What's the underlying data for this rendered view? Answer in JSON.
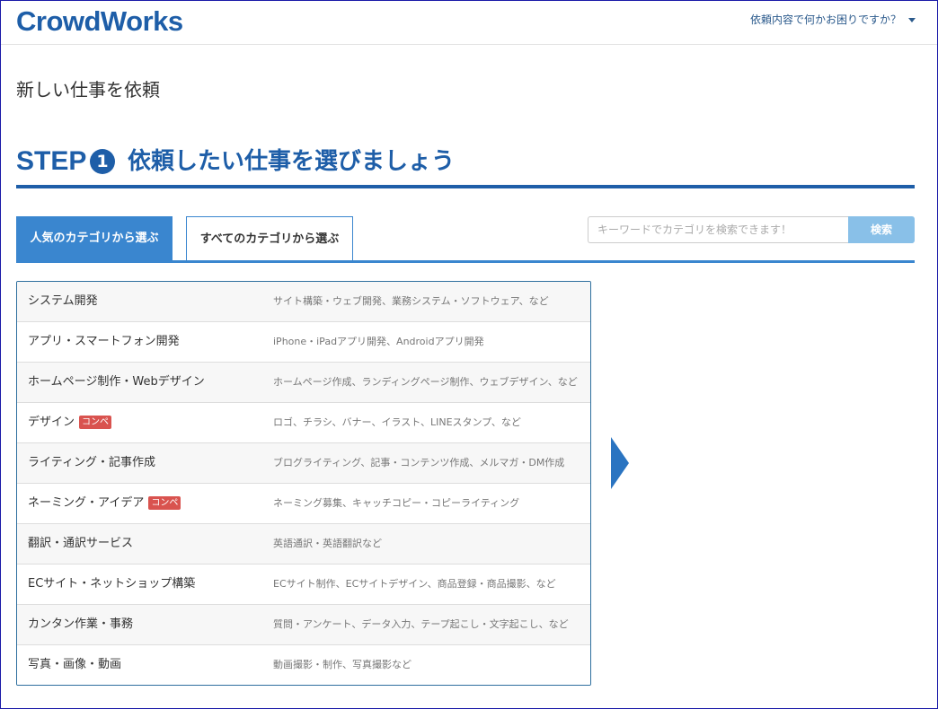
{
  "header": {
    "logo": "CrowdWorks",
    "help_label": "依頼内容で何かお困りですか？"
  },
  "page_title": "新しい仕事を依頼",
  "step": {
    "label": "STEP",
    "number": "1",
    "title": "依頼したい仕事を選びましょう"
  },
  "tabs": [
    {
      "label": "人気のカテゴリから選ぶ",
      "active": true
    },
    {
      "label": "すべてのカテゴリから選ぶ",
      "active": false
    }
  ],
  "search": {
    "placeholder": "キーワードでカテゴリを検索できます！",
    "value": "",
    "button_label": "検索"
  },
  "categories": [
    {
      "name": "システム開発",
      "badge": "",
      "description": "サイト構築・ウェブ開発、業務システム・ソフトウェア、など"
    },
    {
      "name": "アプリ・スマートフォン開発",
      "badge": "",
      "description": "iPhone・iPadアプリ開発、Androidアプリ開発"
    },
    {
      "name": "ホームページ制作・Webデザイン",
      "badge": "",
      "description": "ホームページ作成、ランディングページ制作、ウェブデザイン、など"
    },
    {
      "name": "デザイン",
      "badge": "コンペ",
      "description": "ロゴ、チラシ、バナー、イラスト、LINEスタンプ、など"
    },
    {
      "name": "ライティング・記事作成",
      "badge": "",
      "description": "ブログライティング、記事・コンテンツ作成、メルマガ・DM作成"
    },
    {
      "name": "ネーミング・アイデア",
      "badge": "コンペ",
      "description": "ネーミング募集、キャッチコピー・コピーライティング"
    },
    {
      "name": "翻訳・通訳サービス",
      "badge": "",
      "description": "英語通訳・英語翻訳など"
    },
    {
      "name": "ECサイト・ネットショップ構築",
      "badge": "",
      "description": "ECサイト制作、ECサイトデザイン、商品登録・商品撮影、など"
    },
    {
      "name": "カンタン作業・事務",
      "badge": "",
      "description": "質問・アンケート、データ入力、テープ起こし・文字起こし、など"
    },
    {
      "name": "写真・画像・動画",
      "badge": "",
      "description": "動画撮影・制作、写真撮影など"
    }
  ],
  "colors": {
    "brand": "#1e5ea8",
    "tab_active": "#3a86cf",
    "search_button": "#89c0e8",
    "badge": "#d9534f",
    "arrow": "#2a74c1"
  }
}
